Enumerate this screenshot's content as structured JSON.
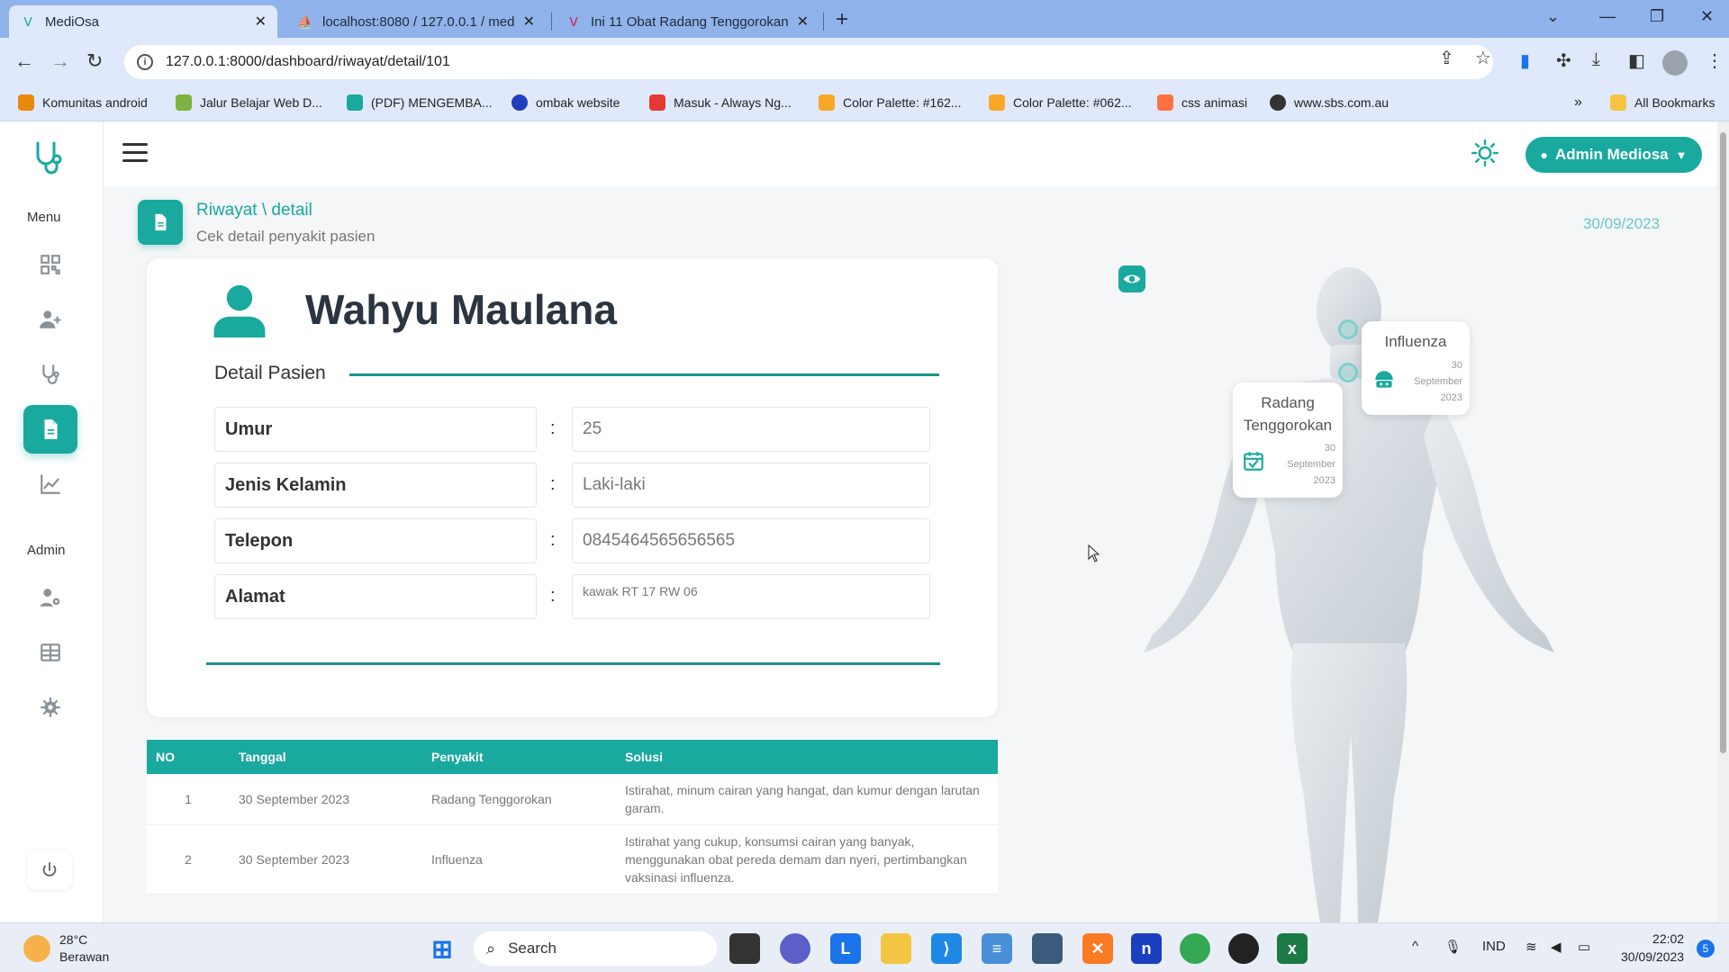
{
  "browser": {
    "tabs": [
      {
        "title": "MediOsa",
        "active": true
      },
      {
        "title": "localhost:8080 / 127.0.0.1 / med",
        "active": false
      },
      {
        "title": "Ini 11 Obat Radang Tenggorokan",
        "active": false
      }
    ],
    "new_tab": "+",
    "url": "127.0.0.1:8000/dashboard/riwayat/detail/101",
    "bookmarks": [
      {
        "label": "Komunitas android",
        "color": "#e8890c"
      },
      {
        "label": "Jalur Belajar Web D...",
        "color": "#7cb342"
      },
      {
        "label": "(PDF) MENGEMBA...",
        "color": "#1aa99f"
      },
      {
        "label": "ombak website",
        "color": "#1e3fbf"
      },
      {
        "label": "Masuk - Always Ng...",
        "color": "#e53935"
      },
      {
        "label": "Color Palette: #162...",
        "color": "#f9a825"
      },
      {
        "label": "Color Palette: #062...",
        "color": "#f9a825"
      },
      {
        "label": "css animasi",
        "color": "#ff7043"
      },
      {
        "label": "www.sbs.com.au",
        "color": "#333333"
      }
    ],
    "bookmarks_overflow": "»",
    "all_bookmarks": "All Bookmarks"
  },
  "sidebar": {
    "menu_label": "Menu",
    "admin_label": "Admin",
    "menu_items": [
      {
        "icon": "dashboard-icon",
        "active": false
      },
      {
        "icon": "add-patient-icon",
        "active": false
      },
      {
        "icon": "stethoscope-icon",
        "active": false
      },
      {
        "icon": "document-icon",
        "active": true
      },
      {
        "icon": "chart-icon",
        "active": false
      }
    ],
    "admin_items": [
      {
        "icon": "user-gear-icon"
      },
      {
        "icon": "table-icon"
      },
      {
        "icon": "settings-icon"
      }
    ]
  },
  "topnav": {
    "admin_button": "Admin Mediosa"
  },
  "breadcrumb": {
    "title": "Riwayat \\ detail",
    "subtitle": "Cek detail penyakit pasien",
    "date": "30/09/2023"
  },
  "patient": {
    "name": "Wahyu Maulana",
    "section_title": "Detail Pasien",
    "fields": [
      {
        "label": "Umur",
        "value": "25"
      },
      {
        "label": "Jenis Kelamin",
        "value": "Laki-laki"
      },
      {
        "label": "Telepon",
        "value": "0845464565656565"
      },
      {
        "label": "Alamat",
        "value": "kawak RT 17 RW 06"
      }
    ],
    "colon": ":"
  },
  "history": {
    "headers": [
      "NO",
      "Tanggal",
      "Penyakit",
      "Solusi"
    ],
    "rows": [
      {
        "no": "1",
        "tanggal": "30 September 2023",
        "penyakit": "Radang Tenggorokan",
        "solusi": "Istirahat, minum cairan yang hangat, dan kumur dengan larutan garam."
      },
      {
        "no": "2",
        "tanggal": "30 September 2023",
        "penyakit": "Influenza",
        "solusi": "Istirahat yang cukup, konsumsi cairan yang banyak, menggunakan obat pereda demam dan nyeri, pertimbangkan vaksinasi influenza."
      }
    ]
  },
  "model": {
    "bubbles": [
      {
        "title": "Influenza",
        "date_lines": [
          "30",
          "September",
          "2023"
        ],
        "icon": "virus-icon"
      },
      {
        "title_lines": [
          "Radang",
          "Tenggorokan"
        ],
        "date_lines": [
          "30",
          "September",
          "2023"
        ],
        "icon": "calendar-check-icon"
      }
    ]
  },
  "taskbar": {
    "weather_temp": "28°C",
    "weather_desc": "Berawan",
    "search": "Search",
    "language": "IND",
    "time": "22:02",
    "date": "30/09/2023",
    "notifications": "5"
  },
  "colors": {
    "accent": "#1aa99f",
    "accent_dark": "#17938b"
  }
}
